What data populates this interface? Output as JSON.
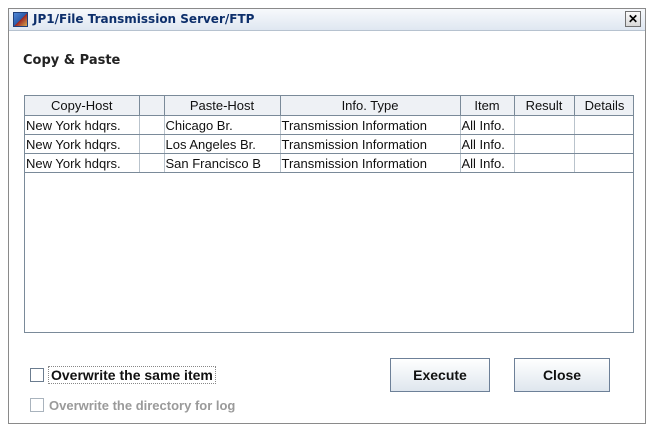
{
  "window": {
    "title": "JP1/File Transmission Server/FTP",
    "close_glyph": "✕"
  },
  "section_title": "Copy & Paste",
  "table": {
    "headers": [
      "Copy-Host",
      "",
      "Paste-Host",
      "Info. Type",
      "Item",
      "Result",
      "Details"
    ],
    "rows": [
      [
        "New York hdqrs.",
        "",
        "Chicago Br.",
        "Transmission Information",
        "All Info.",
        "",
        ""
      ],
      [
        "New York hdqrs.",
        "",
        "Los Angeles Br.",
        "Transmission Information",
        "All Info.",
        "",
        ""
      ],
      [
        "New York hdqrs.",
        "",
        "San Francisco B",
        "Transmission Information",
        "All Info.",
        "",
        ""
      ]
    ]
  },
  "options": {
    "overwrite_same_item": {
      "label": "Overwrite the same item",
      "checked": false,
      "enabled": true
    },
    "overwrite_log_dir": {
      "label": "Overwrite the directory for log",
      "checked": false,
      "enabled": false
    }
  },
  "buttons": {
    "execute": "Execute",
    "close": "Close"
  },
  "icons": {
    "app": "jp1-app-icon",
    "close": "close-icon"
  }
}
